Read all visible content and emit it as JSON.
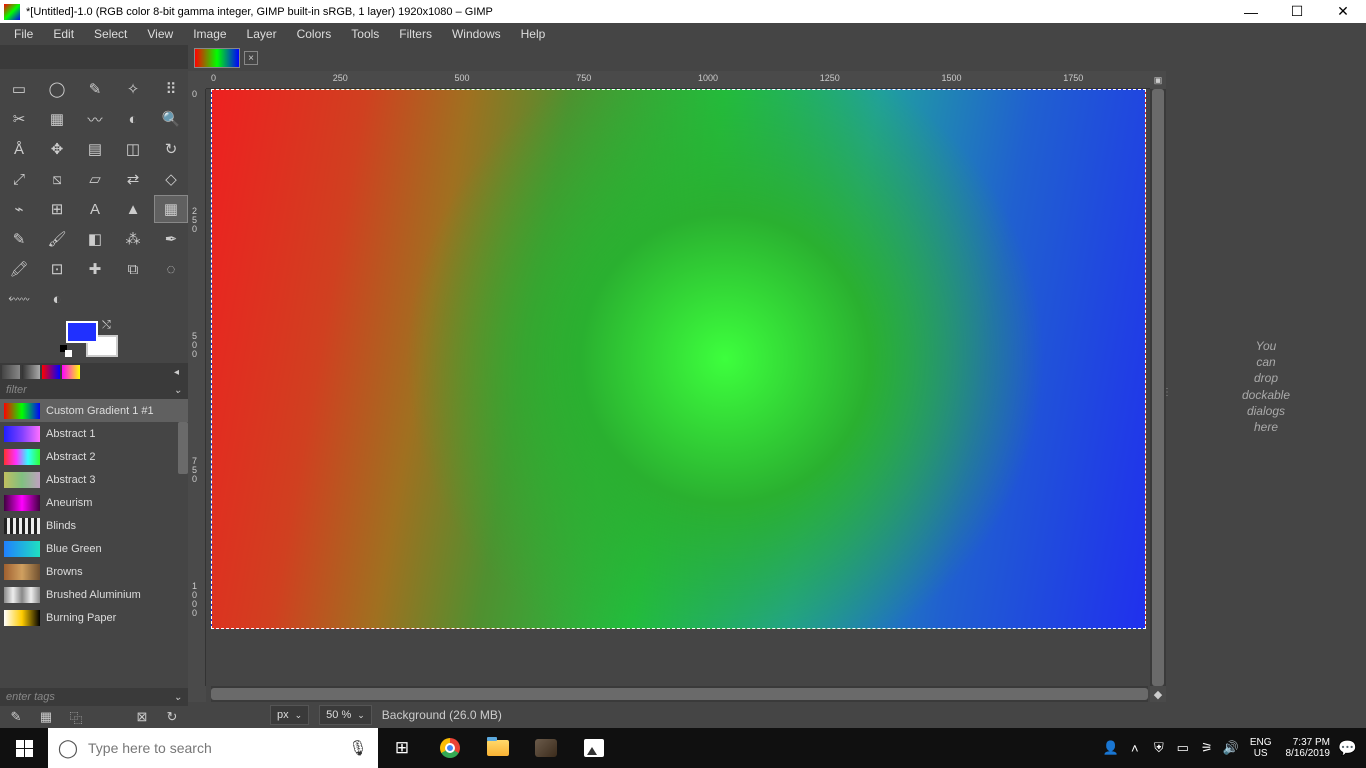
{
  "title": "*[Untitled]-1.0 (RGB color 8-bit gamma integer, GIMP built-in sRGB, 1 layer) 1920x1080 – GIMP",
  "menu": [
    "File",
    "Edit",
    "Select",
    "View",
    "Image",
    "Layer",
    "Colors",
    "Tools",
    "Filters",
    "Windows",
    "Help"
  ],
  "filter_placeholder": "filter",
  "gradients": [
    {
      "name": "Custom Gradient 1 #1",
      "css": "linear-gradient(90deg,#ff0000,#00ff00,#0000ff)",
      "selected": true
    },
    {
      "name": "Abstract 1",
      "css": "linear-gradient(90deg,#2020ff,#8040ff,#ff70ff)"
    },
    {
      "name": "Abstract 2",
      "css": "linear-gradient(90deg,#ff3030,#ff30ff,#30ffff,#30ff30)"
    },
    {
      "name": "Abstract 3",
      "css": "linear-gradient(90deg,#c0c060,#80c080,#c0a0c0)"
    },
    {
      "name": "Aneurism",
      "css": "linear-gradient(90deg,#400040,#ff00ff,#400040)"
    },
    {
      "name": "Blinds",
      "css": "repeating-linear-gradient(90deg,#222 0 3px,#eee 3px 6px)"
    },
    {
      "name": "Blue Green",
      "css": "linear-gradient(90deg,#2080ff,#20e0c0)"
    },
    {
      "name": "Browns",
      "css": "linear-gradient(90deg,#a06030,#d0a060,#705030)"
    },
    {
      "name": "Brushed Aluminium",
      "css": "linear-gradient(90deg,#888,#eee,#888,#eee,#888)"
    },
    {
      "name": "Burning Paper",
      "css": "linear-gradient(90deg,#ffffff,#ffcc00,#000)"
    }
  ],
  "tags_placeholder": "enter tags",
  "ruler_h": [
    "0",
    "250",
    "500",
    "750",
    "1000",
    "1250",
    "1500",
    "1750"
  ],
  "ruler_v": [
    "0",
    "250",
    "500",
    "750",
    "1000"
  ],
  "status": {
    "unit": "px",
    "zoom": "50 %",
    "layer": "Background (26.0 MB)"
  },
  "right_hint": [
    "You",
    "can",
    "drop",
    "dockable",
    "dialogs",
    "here"
  ],
  "search_placeholder": "Type here to search",
  "tray": {
    "lang1": "ENG",
    "lang2": "US",
    "time": "7:37 PM",
    "date": "8/16/2019"
  },
  "tool_names": [
    "rect-select",
    "ellipse-select",
    "free-select",
    "fuzzy-select",
    "color-select",
    "scissors",
    "foreground-select",
    "paths",
    "color-picker",
    "zoom",
    "measure",
    "move",
    "align",
    "crop",
    "rotate",
    "scale",
    "shear",
    "perspective",
    "flip",
    "cage",
    "warp",
    "unified-transform",
    "text",
    "bucket-fill",
    "gradient",
    "pencil",
    "paintbrush",
    "eraser",
    "airbrush",
    "ink",
    "mypaint-brush",
    "clone",
    "heal",
    "perspective-clone",
    "blur-sharpen",
    "smudge",
    "dodge-burn"
  ]
}
